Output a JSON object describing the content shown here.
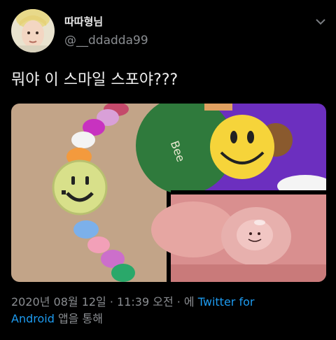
{
  "user": {
    "display_name": "따따형님",
    "handle": "@__ddadda99"
  },
  "tweet": {
    "text": "뭐야 이 스마일 스포야???"
  },
  "meta": {
    "timestamp": "2020년 08월 12일 · 11:39 오전 · 에",
    "source_part1": "Twitter for",
    "source_part2": "Android",
    "source_suffix": "앱을 통해"
  },
  "media": {
    "sticker_text": "Bee"
  },
  "colors": {
    "background": "#000000",
    "link": "#1d9bf0",
    "muted": "#8a8d91"
  },
  "icons": {
    "menu": "chevron-down-icon"
  }
}
